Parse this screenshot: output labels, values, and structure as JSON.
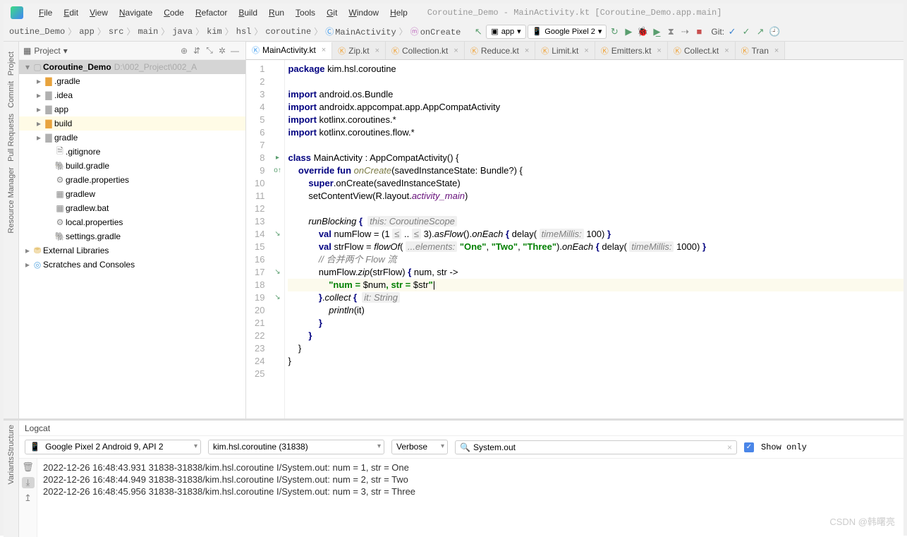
{
  "window": {
    "context": "Coroutine_Demo - MainActivity.kt [Coroutine_Demo.app.main]"
  },
  "menu": [
    "File",
    "Edit",
    "View",
    "Navigate",
    "Code",
    "Refactor",
    "Build",
    "Run",
    "Tools",
    "Git",
    "Window",
    "Help"
  ],
  "breadcrumbs": [
    "outine_Demo",
    "app",
    "src",
    "main",
    "java",
    "kim",
    "hsl",
    "coroutine",
    "MainActivity",
    "onCreate"
  ],
  "run_config": "app",
  "device": "Google Pixel 2",
  "git_label": "Git:",
  "project_pane": {
    "title": "Project",
    "root": {
      "name": "Coroutine_Demo",
      "path": "D:\\002_Project\\002_A"
    },
    "items": [
      {
        "name": ".gradle",
        "indent": 1,
        "folder": true,
        "orange": true
      },
      {
        "name": ".idea",
        "indent": 1,
        "folder": true
      },
      {
        "name": "app",
        "indent": 1,
        "folder": true
      },
      {
        "name": "build",
        "indent": 1,
        "folder": true,
        "orange": true,
        "hl": true
      },
      {
        "name": "gradle",
        "indent": 1,
        "folder": true
      },
      {
        "name": ".gitignore",
        "indent": 2,
        "icon": "🗎"
      },
      {
        "name": "build.gradle",
        "indent": 2,
        "icon": "🐘"
      },
      {
        "name": "gradle.properties",
        "indent": 2,
        "icon": "⚙"
      },
      {
        "name": "gradlew",
        "indent": 2,
        "icon": "▦"
      },
      {
        "name": "gradlew.bat",
        "indent": 2,
        "icon": "▦"
      },
      {
        "name": "local.properties",
        "indent": 2,
        "icon": "⚙"
      },
      {
        "name": "settings.gradle",
        "indent": 2,
        "icon": "🐘"
      }
    ],
    "ext1": "External Libraries",
    "ext2": "Scratches and Consoles"
  },
  "tabs": [
    {
      "label": "MainActivity.kt",
      "active": true,
      "icon_color": "#46a0f0"
    },
    {
      "label": "Zip.kt",
      "icon_color": "#f0a030"
    },
    {
      "label": "Collection.kt",
      "icon_color": "#f0a030"
    },
    {
      "label": "Reduce.kt",
      "icon_color": "#f0a030"
    },
    {
      "label": "Limit.kt",
      "icon_color": "#f0a030"
    },
    {
      "label": "Emitters.kt",
      "icon_color": "#f0a030"
    },
    {
      "label": "Collect.kt",
      "icon_color": "#f0a030"
    },
    {
      "label": "Tran",
      "icon_color": "#f0a030"
    }
  ],
  "code": {
    "lines": [
      {
        "n": 1,
        "html": "<span class='kw'>package</span> kim.hsl.coroutine"
      },
      {
        "n": 2,
        "html": ""
      },
      {
        "n": 3,
        "html": "<span class='kw'>import</span> android.os.Bundle"
      },
      {
        "n": 4,
        "html": "<span class='kw'>import</span> androidx.appcompat.app.AppCompatActivity"
      },
      {
        "n": 5,
        "html": "<span class='kw'>import</span> kotlinx.coroutines.*"
      },
      {
        "n": 6,
        "html": "<span class='kw'>import</span> kotlinx.coroutines.flow.*"
      },
      {
        "n": 7,
        "html": ""
      },
      {
        "n": 8,
        "html": "<span class='kw'>class</span> MainActivity : AppCompatActivity() {",
        "gut": "▸"
      },
      {
        "n": 9,
        "html": "    <span class='kw'>override fun</span> <span class='fn'>onCreate</span>(savedInstanceState: Bundle?) {",
        "gut": "o↑"
      },
      {
        "n": 10,
        "html": "        <span class='kw'>super</span>.onCreate(savedInstanceState)"
      },
      {
        "n": 11,
        "html": "        setContentView(R.layout.<span class='id'>activity_main</span>)"
      },
      {
        "n": 12,
        "html": ""
      },
      {
        "n": 13,
        "html": "        <span class='itc'>runBlocking</span> <span class='kw'>{</span>  <span class='ann'>this: CoroutineScope</span>"
      },
      {
        "n": 14,
        "html": "            <span class='kw'>val</span> numFlow = (1 <span class='ann'>≤</span> .. <span class='ann'>≤</span> 3).<span class='itc'>asFlow</span>().<span class='itc'>onEach</span> <span class='kw'>{</span> delay( <span class='ann'>timeMillis:</span> 100) <span class='kw'>}</span>",
        "gut": "↘"
      },
      {
        "n": 15,
        "html": "            <span class='kw'>val</span> strFlow = <span class='itc'>flowOf</span>( <span class='ann'>...elements:</span> <span class='str'>\"One\"</span>, <span class='str'>\"Two\"</span>, <span class='str'>\"Three\"</span>).<span class='itc'>onEach</span> <span class='kw'>{</span> delay( <span class='ann'>timeMillis:</span> 1000) <span class='kw'>}</span>"
      },
      {
        "n": 16,
        "html": "            <span class='cm'>// 合并两个 Flow 流</span>"
      },
      {
        "n": 17,
        "html": "            numFlow.<span class='itc'>zip</span>(strFlow) <span class='kw'>{</span> num, str -&gt;",
        "gut": "↘"
      },
      {
        "n": 18,
        "html": "                <span class='str'>\"num = </span>$num<span class='str'>, str = </span>$str<span class='str'>\"</span><span class='caret'>|</span>",
        "cur": true
      },
      {
        "n": 19,
        "html": "            <span class='kw'>}</span>.<span class='itc'>collect</span> <span class='kw'>{</span>  <span class='ann'>it: String</span>",
        "gut": "↘"
      },
      {
        "n": 20,
        "html": "                <span class='itc'>println</span>(it)"
      },
      {
        "n": 21,
        "html": "            <span class='kw'>}</span>"
      },
      {
        "n": 22,
        "html": "        <span class='kw'>}</span>"
      },
      {
        "n": 23,
        "html": "    }"
      },
      {
        "n": 24,
        "html": "}"
      },
      {
        "n": 25,
        "html": ""
      }
    ]
  },
  "logcat": {
    "title": "Logcat",
    "device": "Google Pixel 2 Android 9, API 2",
    "process": "kim.hsl.coroutine (31838)",
    "level": "Verbose",
    "filter": "System.out",
    "show_only": "Show only",
    "lines": [
      "2022-12-26 16:48:43.931 31838-31838/kim.hsl.coroutine I/System.out: num = 1, str = One",
      "2022-12-26 16:48:44.949 31838-31838/kim.hsl.coroutine I/System.out: num = 2, str = Two",
      "2022-12-26 16:48:45.956 31838-31838/kim.hsl.coroutine I/System.out: num = 3, str = Three"
    ]
  },
  "left_tabs": [
    "Project",
    "Commit",
    "Pull Requests",
    "Resource Manager"
  ],
  "bottom_left_tabs": [
    "Structure",
    "Variants"
  ],
  "watermark": "CSDN @韩曙亮"
}
